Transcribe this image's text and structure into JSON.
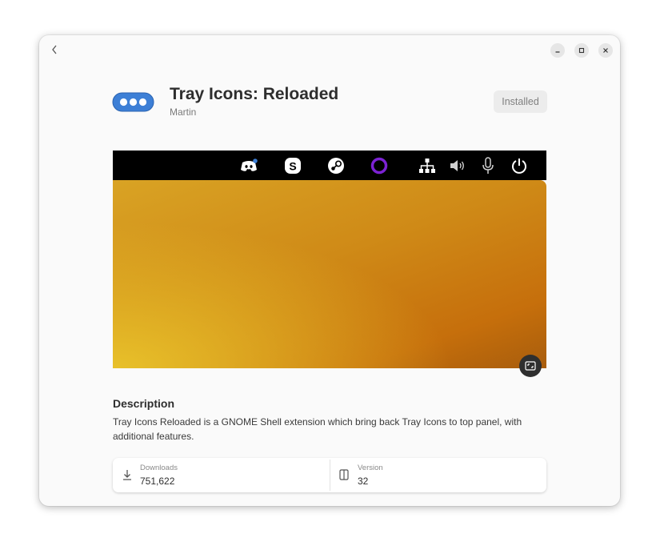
{
  "app": {
    "title": "Tray Icons: Reloaded",
    "author": "Martin",
    "install_status": "Installed",
    "icon": "three-dots-pill-icon",
    "accent_color": "#3d7fd6"
  },
  "window_controls": [
    "back-icon",
    "minimize-icon",
    "maximize-icon",
    "close-icon"
  ],
  "screenshot": {
    "tray_icons": [
      "discord-icon",
      "skype-icon",
      "steam-icon",
      "ring-icon",
      "network-icon",
      "volume-icon",
      "microphone-icon",
      "power-icon"
    ],
    "expand_icon": "fullscreen-icon"
  },
  "description": {
    "heading": "Description",
    "text": "Tray Icons Reloaded is a GNOME Shell extension which bring back Tray Icons to top panel, with additional features."
  },
  "details": {
    "downloads_label": "Downloads",
    "downloads_value": "751,622",
    "version_label": "Version",
    "version_value": "32"
  }
}
